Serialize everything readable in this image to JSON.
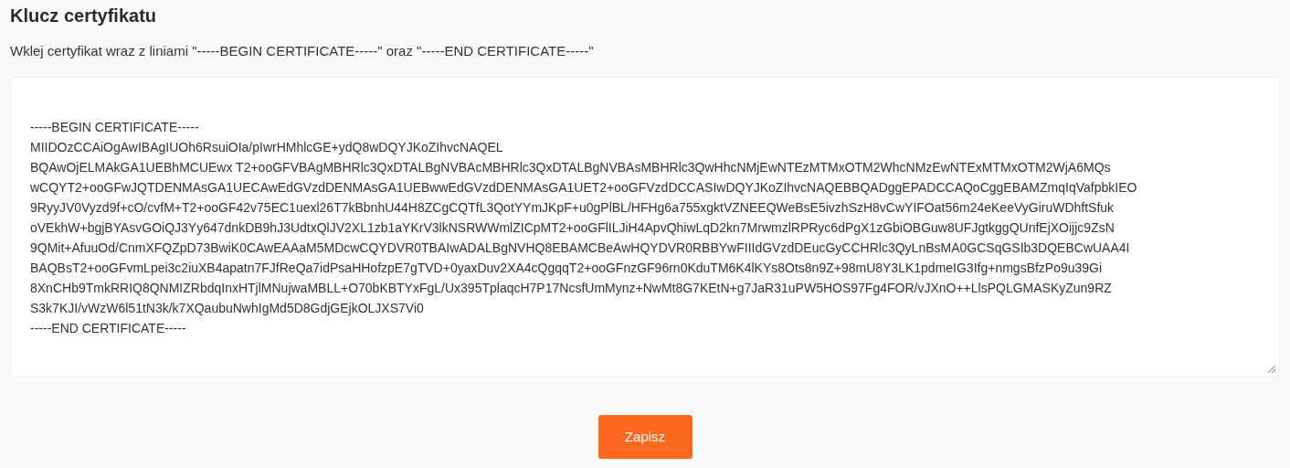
{
  "title": "Klucz certyfikatu",
  "hint": "Wklej certyfikat wraz z liniami \"-----BEGIN CERTIFICATE-----\" oraz \"-----END CERTIFICATE-----\"",
  "certificate_field": {
    "value_lines": [
      "-----BEGIN CERTIFICATE-----",
      "MIIDOzCCAiOgAwIBAgIUOh6RsuiOIa/pIwrHMhlcGE+ydQ8wDQYJKoZIhvcNAQEL",
      "BQAwOjELMAkGA1UEBhMCUEwx T2+ooGFVBAgMBHRlc3QxDTALBgNVBAcMBHRlc3QxDTALBgNVBAsMBHRlc3QwHhcNMjEwNTEzMTMxOTM2WhcNMzEwNTExMTMxOTM2WjA6MQs",
      "wCQYT2+ooGFwJQTDENMAsGA1UECAwEdGVzdDENMAsGA1UEBwwEdGVzdDENMAsGA1UET2+ooGFVzdDCCASIwDQYJKoZIhvcNAQEBBQADggEPADCCAQoCggEBAMZmqIqVafpbkIEO",
      "9RyyJV0Vyzd9f+cO/cvfM+T2+ooGF42v75EC1uexl26T7kBbnhU44H8ZCgCQTfL3QotYYmJKpF+u0gPlBL/HFHg6a755xgktVZNEEQWeBsE5ivzhSzH8vCwYIFOat56m24eKeeVyGiruWDhftSfuk",
      "oVEkhW+bgjBYAsvGOiQJ3Yy647dnkDB9hJ3UdtxQlJV2XL1zb1aYKrV3lkNSRWWmlZICpMT2+ooGFlILJiH4ApvQhiwLqD2kn7MrwmzlRPRyc6dPgX1zGbiOBGuw8UFJgtkggQUnfEjXOijjc9ZsN",
      "9QMit+AfuuOd/CnmXFQZpD73BwiK0CAwEAAaM5MDcwCQYDVR0TBAIwADALBgNVHQ8EBAMCBeAwHQYDVR0RBBYwFIIIdGVzdDEucGyCCHRlc3QyLnBsMA0GCSqGSIb3DQEBCwUAA4I",
      "BAQBsT2+ooGFvmLpei3c2iuXB4apatn7FJfReQa7idPsaHHofzpE7gTVD+0yaxDuv2XA4cQgqqT2+ooGFnzGF96rn0KduTM6K4lKYs8Ots8n9Z+98mU8Y3LK1pdmeIG3Ifg+nmgsBfzPo9u39Gi",
      "8XnCHb9TmkRRIQ8QNMIZRbdqInxHTjlMNujwaMBLL+O70bKBTYxFgL/Ux395TplaqcH7P17NcsfUmMynz+NwMt8G7KEtN+g7JaR31uPW5HOS97Fg4FOR/vJXnO++LlsPQLGMASKyZun9RZ",
      "S3k7KJI/vWzW6l51tN3k/k7XQaubuNwhIgMd5D8GdjGEjkOLJXS7Vi0",
      "-----END CERTIFICATE-----"
    ]
  },
  "save_button": "Zapisz"
}
